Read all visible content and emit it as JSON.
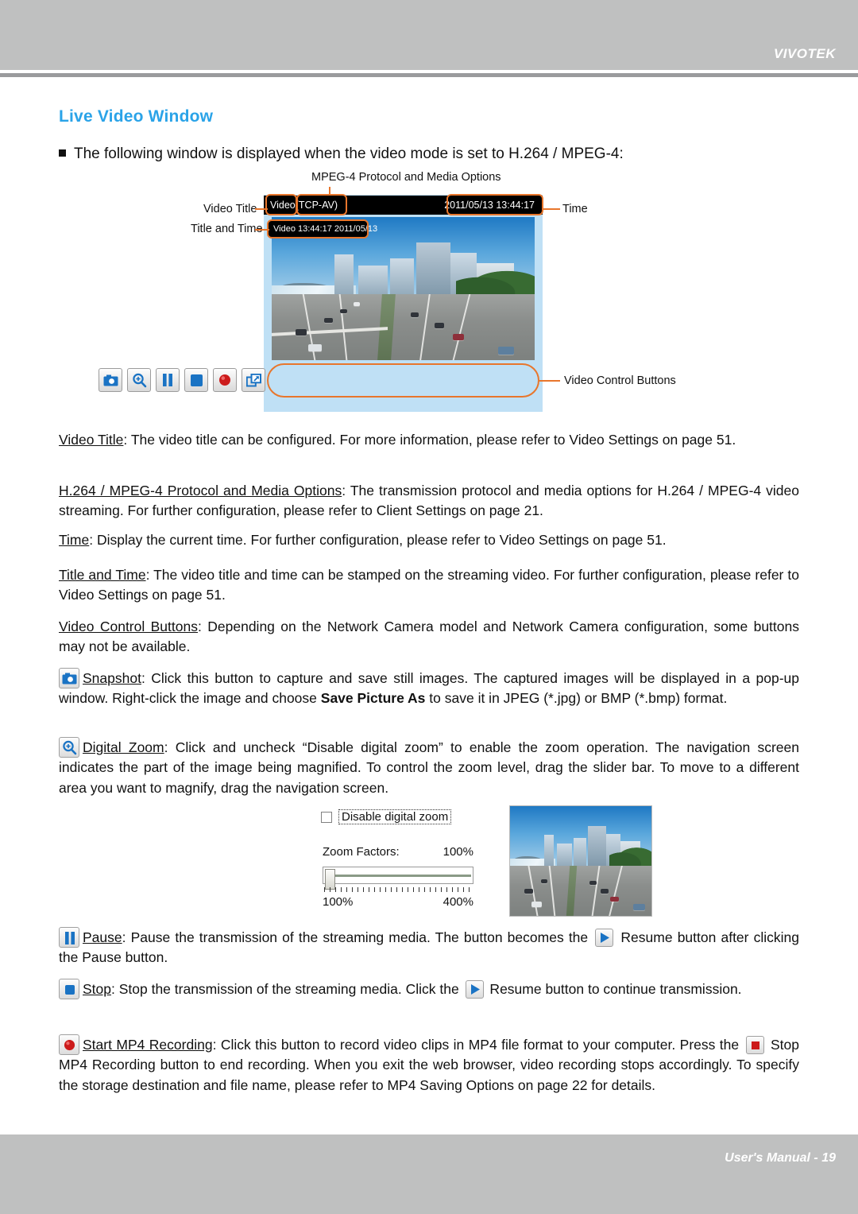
{
  "header": {
    "brand": "VIVOTEK"
  },
  "footer": {
    "text": "User's Manual - 19"
  },
  "section": {
    "title": "Live Video Window",
    "bullet": "The following window is displayed when the video mode is set to H.264 / MPEG-4:"
  },
  "figure": {
    "caption_protocol": "MPEG-4 Protocol and Media Options",
    "label_video_title": "Video Title",
    "label_title_and_time": "Title and Time",
    "label_time": "Time",
    "label_video_control_buttons": "Video Control Buttons",
    "titlebar_left_title": "Video",
    "titlebar_left_protocol": "(TCP-AV)",
    "titlebar_right_datetime": "2011/05/13 13:44:17",
    "osd_stamp": "Video 13:44:17  2011/05/13",
    "buttons": [
      {
        "name": "snapshot-icon",
        "label": "Snapshot"
      },
      {
        "name": "digital-zoom-icon",
        "label": "Digital Zoom"
      },
      {
        "name": "pause-icon",
        "label": "Pause"
      },
      {
        "name": "stop-icon",
        "label": "Stop"
      },
      {
        "name": "record-icon",
        "label": "Start MP4 Recording"
      },
      {
        "name": "fullscreen-icon",
        "label": "Full Screen"
      }
    ]
  },
  "paragraphs": {
    "video_title": {
      "term": "Video Title",
      "body": ": The video title can be configured. For more information, please refer to Video Settings on page 51."
    },
    "protocol": {
      "term": "H.264 / MPEG-4 Protocol and Media Options",
      "body": ": The transmission protocol and media options for H.264 / MPEG-4 video streaming. For further configuration, please refer to Client Settings on page 21."
    },
    "time": {
      "term": "Time",
      "body": ": Display the current time. For further configuration, please refer to Video Settings on page 51."
    },
    "title_and_time": {
      "term": "Title and Time",
      "body": ": The video title and time can be stamped on the streaming video. For further configuration, please refer to Video Settings on page 51."
    },
    "video_control_buttons": {
      "term": "Video Control Buttons",
      "body": ": Depending on the Network Camera model and Network Camera configuration, some buttons may not be available."
    },
    "snapshot": {
      "term": "Snapshot",
      "body_1": ": Click this button to capture and save still images. The captured images will be displayed in a pop-up window. Right-click the image and choose ",
      "bold": "Save Picture As",
      "body_2": " to save it in JPEG (*.jpg) or BMP (*.bmp) format."
    },
    "digital_zoom": {
      "term": "Digital Zoom",
      "body": ": Click and uncheck “Disable digital zoom” to enable the zoom operation. The navigation screen indicates the part of the image being magnified. To control the zoom level, drag the slider bar. To move to a different area you want to magnify, drag the navigation screen."
    },
    "pause": {
      "term": "Pause",
      "body_1": ": Pause the transmission of the streaming media. The button becomes the ",
      "body_2": " Resume button after clicking the Pause button."
    },
    "stop": {
      "term": "Stop",
      "body_1": ": Stop the transmission of the streaming media. Click the ",
      "body_2": " Resume button to continue transmission."
    },
    "record": {
      "term": "Start MP4 Recording",
      "body_1": ": Click this button to record video clips in MP4 file format to your computer. Press the ",
      "body_2": " Stop MP4 Recording button to end recording. When you exit the web browser, video recording stops accordingly. To specify the storage destination and file name, please refer to MP4 Saving Options on page 22 for details."
    }
  },
  "digital_zoom_dialog": {
    "checkbox_label": "Disable digital zoom",
    "zoom_factors_label": "Zoom Factors:",
    "zoom_factors_value": "100%",
    "slider_min": "100%",
    "slider_max": "400%"
  },
  "colors": {
    "accent_heading": "#2aa3e8",
    "annotation_orange": "#e8762c",
    "chrome_gray": "#bfc0c0",
    "panel_blue": "#bfe0f5"
  }
}
